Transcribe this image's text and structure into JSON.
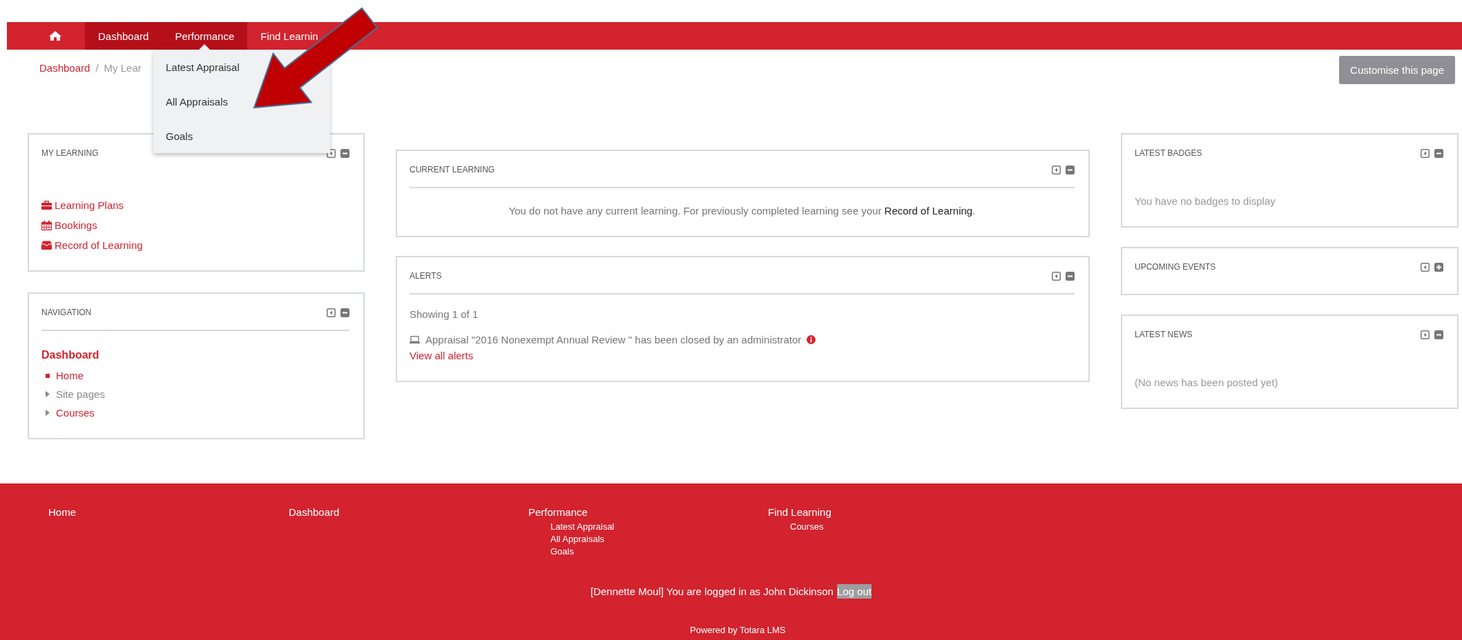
{
  "navbar": {
    "items": [
      {
        "label": "Dashboard",
        "selected": true,
        "expanded": false
      },
      {
        "label": "Performance",
        "selected": true,
        "expanded": true
      },
      {
        "label": "Find Learnin",
        "selected": false,
        "expanded": false
      }
    ]
  },
  "dropdown": {
    "items": [
      "Latest Appraisal",
      "All Appraisals",
      "Goals"
    ]
  },
  "breadcrumb": {
    "items": [
      "Dashboard",
      "My Lear"
    ],
    "separator": "/"
  },
  "customise_button": "Customise this page",
  "columns": [
    {
      "blocks": [
        {
          "kind": "links",
          "title": "MY LEARNING",
          "expanded": true,
          "divider": false,
          "items": [
            {
              "kind": "briefcase",
              "label": "Learning Plans"
            },
            {
              "kind": "calendar",
              "label": "Bookings"
            },
            {
              "kind": "archive",
              "label": "Record of Learning"
            }
          ]
        },
        {
          "kind": "tree",
          "title": "NAVIGATION",
          "expanded": true,
          "divider": true,
          "root": "Dashboard",
          "children": [
            {
              "kind": "bullet",
              "link": true,
              "label": "Home"
            },
            {
              "kind": "expandable",
              "link": false,
              "label": "Site pages"
            },
            {
              "kind": "expandable",
              "link": true,
              "label": "Courses"
            }
          ]
        }
      ]
    },
    {
      "blocks": [
        {
          "kind": "message",
          "title": "CURRENT LEARNING",
          "expanded": true,
          "divider": true,
          "text": "You do not have any current learning. For previously completed learning see your ",
          "link": "Record of Learning",
          "end": "."
        },
        {
          "kind": "alerts",
          "title": "ALERTS",
          "expanded": true,
          "divider": true,
          "count": "Showing 1 of 1",
          "alerts": [
            "Appraisal \"2016 Nonexempt Annual Review \" has been closed by an administrator"
          ],
          "link": "View all alerts"
        }
      ]
    },
    {
      "blocks": [
        {
          "kind": "text",
          "title": "LATEST BADGES",
          "expanded": true,
          "divider": false,
          "text": "You have no badges to display"
        },
        {
          "title": "UPCOMING EVENTS",
          "expanded": false,
          "divider": false
        },
        {
          "kind": "text",
          "title": "LATEST NEWS",
          "expanded": true,
          "divider": false,
          "text": "(No news has been posted yet)"
        }
      ]
    }
  ],
  "footer": {
    "columns": [
      {
        "title": "Home"
      },
      {
        "title": "Dashboard"
      },
      {
        "title": "Performance",
        "items": [
          "Latest Appraisal",
          "All Appraisals",
          "Goals"
        ]
      },
      {
        "title": "Find Learning",
        "items": [
          "Courses"
        ]
      }
    ],
    "login_text": "[Dennette Moul] You are logged in as John Dickinson",
    "logout": {
      "label": "Log out",
      "highlighted": true
    },
    "powered_by": "Powered by Totara LMS"
  }
}
